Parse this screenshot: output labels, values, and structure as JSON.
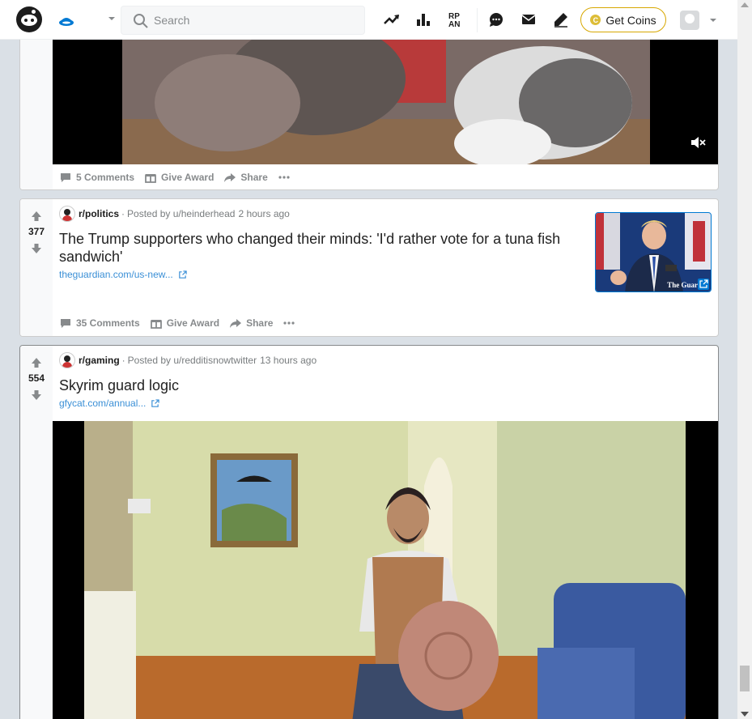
{
  "header": {
    "search_placeholder": "Search",
    "get_coins_label": "Get Coins",
    "coin_symbol": "C"
  },
  "icons": [
    "reddit-logo-icon",
    "home-icon",
    "chevron-down-icon",
    "search-icon",
    "trending-icon",
    "leaderboard-icon",
    "rpan-icon",
    "chat-icon",
    "mail-icon",
    "pencil-icon",
    "coin-icon",
    "avatar",
    "upvote-icon",
    "downvote-icon",
    "comment-icon",
    "gift-icon",
    "share-icon",
    "more-icon",
    "external-link-icon",
    "mute-icon"
  ],
  "colors": {
    "accent": "#0079d3",
    "link": "#3a8fd6",
    "coins_border": "#d7a700",
    "background": "#dae0e6"
  },
  "posts": [
    {
      "id": "video-cats",
      "comments": "5 Comments",
      "give_award": "Give Award",
      "share": "Share"
    },
    {
      "id": "politics",
      "score": "377",
      "subreddit": "r/politics",
      "posted_by": "Posted by u/heinderhead",
      "time": "2 hours ago",
      "title": "The Trump supporters who changed their minds: 'I'd rather vote for a tuna fish sandwich'",
      "link": "theguardian.com/us-new...",
      "comments": "35 Comments",
      "give_award": "Give Award",
      "share": "Share",
      "thumbnail_caption": "The Guar"
    },
    {
      "id": "gaming",
      "score": "554",
      "subreddit": "r/gaming",
      "posted_by": "Posted by u/redditisnowtwitter",
      "time": "13 hours ago",
      "title": "Skyrim guard logic",
      "link": "gfycat.com/annual..."
    }
  ]
}
